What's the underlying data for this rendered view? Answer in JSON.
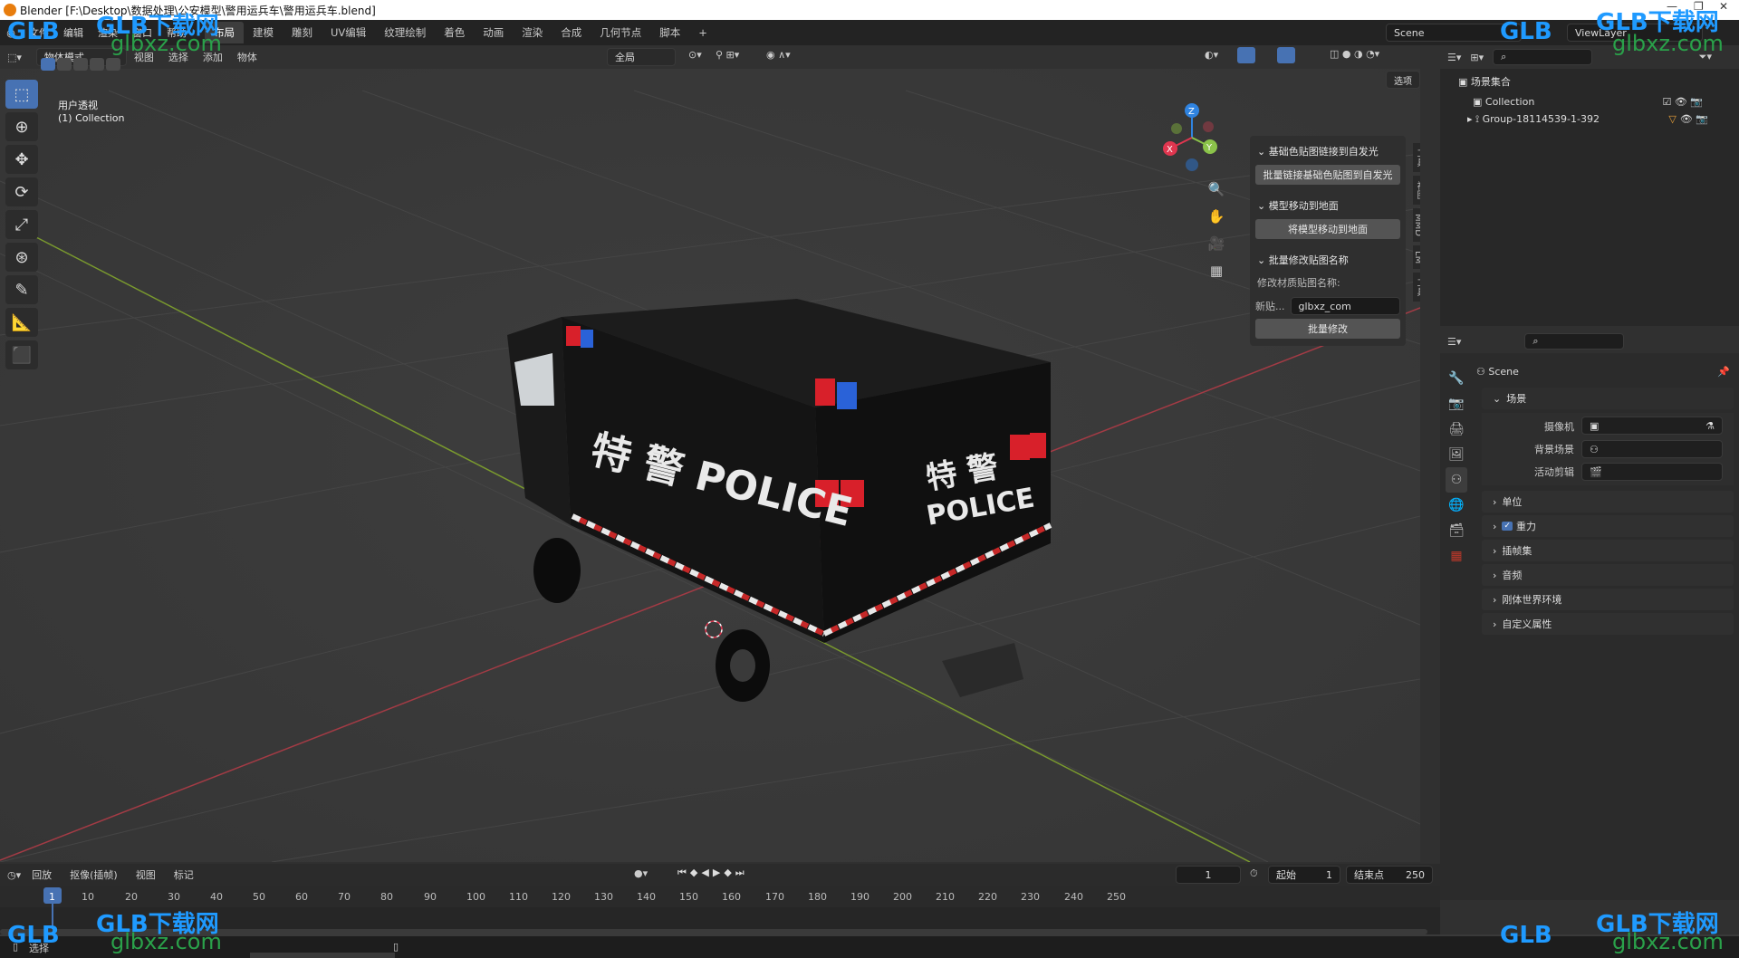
{
  "window": {
    "title": "Blender [F:\\Desktop\\数据处理\\公安模型\\警用运兵车\\警用运兵车.blend]"
  },
  "menus": [
    "文件",
    "编辑",
    "渲染",
    "窗口",
    "帮助"
  ],
  "workspaces": [
    "布局",
    "建模",
    "雕刻",
    "UV编辑",
    "纹理绘制",
    "着色",
    "动画",
    "渲染",
    "合成",
    "几何节点",
    "脚本"
  ],
  "active_workspace": "布局",
  "scene_field": "Scene",
  "viewlayer_field": "ViewLayer",
  "viewport": {
    "mode": "物体模式",
    "menus": [
      "视图",
      "选择",
      "添加",
      "物体"
    ],
    "orientation": "全局",
    "options": "选项",
    "overlay_title": "用户透视",
    "overlay_sub": "(1) Collection",
    "gizmo": {
      "x": "X",
      "y": "Y",
      "z": "Z"
    },
    "vehicle_text": {
      "front": "特  警 POLICE",
      "side_top": "特  警",
      "side_bottom": "POLICE"
    }
  },
  "npanel": {
    "sec1_title": "基础色贴图链接到自发光",
    "sec1_btn": "批量链接基础色贴图到自发光",
    "sec2_title": "模型移动到地面",
    "sec2_btn": "将模型移动到地面",
    "sec3_title": "批量修改贴图名称",
    "sec3_label": "修改材质贴图名称:",
    "sec3_field_label": "新贴...",
    "sec3_field_value": "glbxz_com",
    "sec3_btn": "批量修改",
    "tabs": [
      "工具",
      "视图",
      "MMD",
      "LM",
      "工具"
    ]
  },
  "outliner": {
    "root": "场景集合",
    "items": [
      {
        "label": "Collection"
      },
      {
        "label": "Group-18114539-1-392"
      }
    ]
  },
  "properties": {
    "scene_name": "Scene",
    "section": "场景",
    "camera_label": "摄像机",
    "bg_scene_label": "背景场景",
    "active_clip_label": "活动剪辑",
    "subpanels": [
      "单位",
      "重力",
      "插帧集",
      "音频",
      "刚体世界环境",
      "自定义属性"
    ]
  },
  "timeline": {
    "menus": [
      "回放",
      "抠像(插帧)",
      "视图",
      "标记"
    ],
    "current_frame": "1",
    "start_label": "起始",
    "start_value": "1",
    "end_label": "结束点",
    "end_value": "250",
    "ticks": [
      "1",
      "10",
      "20",
      "30",
      "40",
      "50",
      "60",
      "70",
      "80",
      "90",
      "100",
      "110",
      "120",
      "130",
      "140",
      "150",
      "160",
      "170",
      "180",
      "190",
      "200",
      "210",
      "220",
      "230",
      "240",
      "250"
    ]
  },
  "statusbar": {
    "left": "选择"
  },
  "watermark": {
    "brand": "GLB下载网",
    "site": "glbxz.com",
    "logo": "GLB"
  },
  "colors": {
    "accent": "#4772b3",
    "axis_x": "#e0364f",
    "axis_y": "#8bc34a",
    "axis_z": "#2f83e0",
    "titlebar": "#ffffff"
  }
}
